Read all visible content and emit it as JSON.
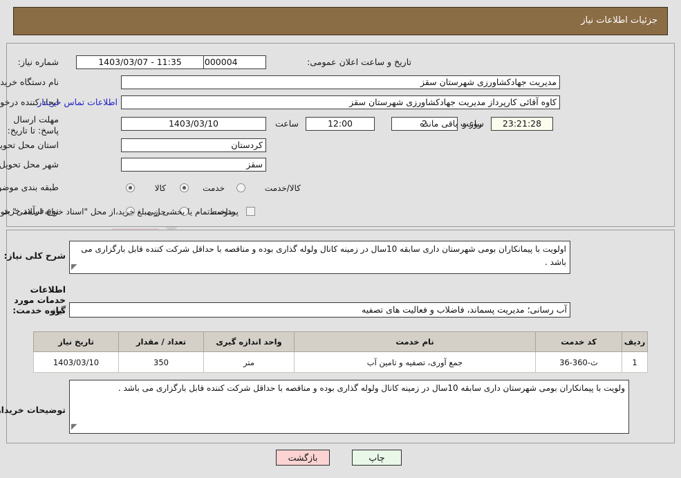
{
  "header": {
    "title": "جزئیات اطلاعات نیاز"
  },
  "watermark": {
    "text": "AriaTender.net"
  },
  "form": {
    "need_number_label": "شماره نیاز:",
    "need_number_value": "1103004699000004",
    "public_announce_label": "تاریخ و ساعت اعلان عمومی:",
    "public_announce_value": "11:35 - 1403/03/07",
    "buyer_org_label": "نام دستگاه خریدار:",
    "buyer_org_value": "مدیریت جهادکشاورزی شهرستان سقز",
    "requester_label": "ایجاد کننده درخواست:",
    "requester_value": "کاوه آقائی کارپرداز مدیریت جهادکشاورزی شهرستان سقز",
    "contact_link": "اطلاعات تماس خریدار",
    "deadline_label": "مهلت ارسال پاسخ: تا تاریخ:",
    "deadline_date": "1403/03/10",
    "hour_label": "ساعت",
    "deadline_time": "12:00",
    "remaining_days": "2",
    "days_and_label": "روز و",
    "remaining_time": "23:21:28",
    "remaining_suffix": "ساعت باقی مانده",
    "province_label": "استان محل تحویل:",
    "province_value": "کردستان",
    "city_label": "شهر محل تحویل:",
    "city_value": "سقز",
    "category_label": "طبقه بندی موضوعی:",
    "category_options": [
      {
        "label": "کالا",
        "selected": false
      },
      {
        "label": "خدمت",
        "selected": true
      },
      {
        "label": "کالا/خدمت",
        "selected": false
      }
    ],
    "purchase_type_label": "نوع فرآیند خرید :",
    "purchase_type_options": [
      {
        "label": "جزیی",
        "selected": false
      },
      {
        "label": "متوسط",
        "selected": false
      }
    ],
    "treasury_checkbox_label": "پرداخت تمام یا بخشی از مبلغ خرید،از محل \"اسناد خزانه اسلامی\" خواهد بود.",
    "treasury_checked": false
  },
  "need_description": {
    "label": "شرح کلی نیاز:",
    "value": "اولویت با پیمانکاران بومی شهرستان داری سابقه 10سال در زمینه کانال ولوله گذاری بوده و مناقصه با حداقل شرکت کننده قابل بارگزاری می باشد ."
  },
  "services_section": {
    "heading": "اطلاعات خدمات مورد نیاز",
    "group_label": "گروه خدمت:",
    "group_value": "آب رسانی؛ مدیریت پسماند، فاضلاب و فعالیت های تصفیه"
  },
  "table": {
    "headers": [
      "ردیف",
      "کد خدمت",
      "نام خدمت",
      "واحد اندازه گیری",
      "تعداد / مقدار",
      "تاریخ نیاز"
    ],
    "rows": [
      {
        "row_no": "1",
        "service_code": "ث-360-36",
        "service_name": "جمع آوری، تصفیه و تامین آب",
        "unit": "متر",
        "quantity": "350",
        "need_date": "1403/03/10"
      }
    ]
  },
  "buyer_notes": {
    "label": "توضیحات خریدار:",
    "value": "ولویت با پیمانکاران بومی شهرستان داری سابقه 10سال در زمینه کانال ولوله گذاری بوده و مناقصه با حداقل شرکت کننده قابل بارگزاری می باشد ."
  },
  "buttons": {
    "print": "چاپ",
    "back": "بازگشت"
  }
}
